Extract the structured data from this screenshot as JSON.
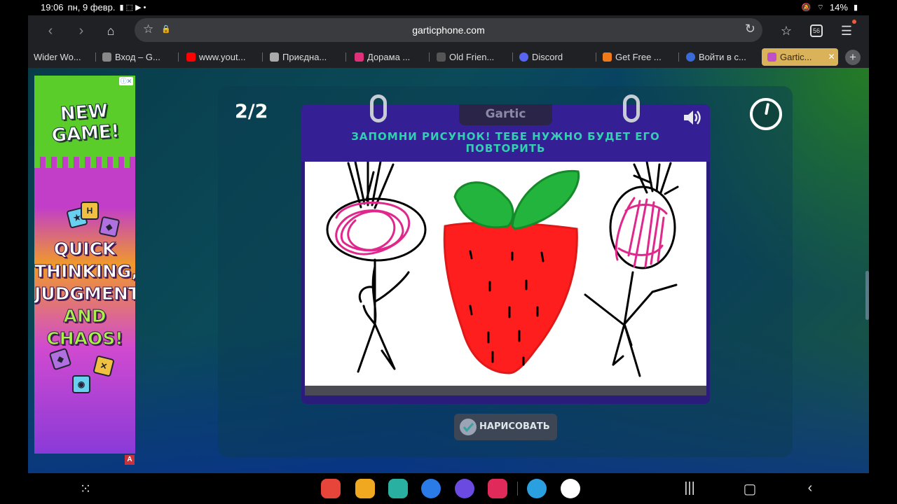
{
  "status_bar": {
    "time": "19:06",
    "date": "пн, 9 февр.",
    "battery": "14%"
  },
  "browser": {
    "url": "garticphone.com",
    "tab_count": "56",
    "tabs": [
      {
        "label": "Wider Wo...",
        "color": "#444444"
      },
      {
        "label": "Вход – G...",
        "color": "#888888"
      },
      {
        "label": "www.yout...",
        "color": "#ff0000"
      },
      {
        "label": "Приєдна...",
        "color": "#aaaaaa"
      },
      {
        "label": "Дорама ...",
        "color": "#e0307a"
      },
      {
        "label": "Old Frien...",
        "color": "#555555"
      },
      {
        "label": "Discord",
        "color": "#5865f2"
      },
      {
        "label": "Get Free ...",
        "color": "#f07a1a"
      },
      {
        "label": "Войти в с...",
        "color": "#3a6ad8"
      },
      {
        "label": "Gartic...",
        "color": "#c050c8"
      }
    ]
  },
  "ad": {
    "headline": "NEW GAME!",
    "body_lines": [
      "QUICK",
      "THINKING,",
      "JUDGMENT"
    ],
    "and_line": "AND",
    "chaos_line": "CHAOS!",
    "badge": "A"
  },
  "game": {
    "round_counter": "2/2",
    "brand": "Gartic",
    "instruction": "ЗАПОМНИ РИСУНОК! ТЕБЕ НУЖНО БУДЕТ ЕГО ПОВТОРИТЬ",
    "draw_button": "НАРИСОВАТЬ",
    "timer_progress": 0.03
  },
  "drawing": {
    "subjects": [
      "beet-figure-left",
      "strawberry",
      "beet-figure-right"
    ],
    "colors": {
      "stroke": "#000000",
      "beet": "#e0288c",
      "berry": "#ff1e1e",
      "leaf": "#22b43c"
    }
  },
  "colors": {
    "accent_teal": "#30d0b0",
    "card_purple": "#351f95",
    "active_tab": "#d9b25a"
  }
}
